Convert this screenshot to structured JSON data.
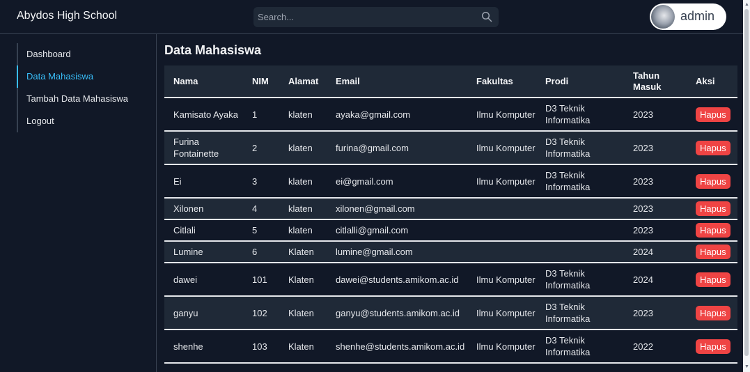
{
  "brand": "Abydos High School",
  "search": {
    "placeholder": "Search..."
  },
  "user": {
    "name": "admin"
  },
  "sidebar": {
    "items": [
      {
        "label": "Dashboard"
      },
      {
        "label": "Data Mahasiswa",
        "active": true
      },
      {
        "label": "Tambah Data Mahasiswa"
      },
      {
        "label": "Logout"
      }
    ]
  },
  "main": {
    "title": "Data Mahasiswa",
    "table": {
      "headers": [
        "Nama",
        "NIM",
        "Alamat",
        "Email",
        "Fakultas",
        "Prodi",
        "Tahun Masuk",
        "Aksi"
      ],
      "rows": [
        {
          "nama": "Kamisato Ayaka",
          "nim": "1",
          "alamat": "klaten",
          "email": "ayaka@gmail.com",
          "fakultas": "Ilmu Komputer",
          "prodi": "D3 Teknik Informatika",
          "tahun": "2023",
          "aksi": "Hapus"
        },
        {
          "nama": "Furina Fontainette",
          "nim": "2",
          "alamat": "klaten",
          "email": "furina@gmail.com",
          "fakultas": "Ilmu Komputer",
          "prodi": "D3 Teknik Informatika",
          "tahun": "2023",
          "aksi": "Hapus"
        },
        {
          "nama": "Ei",
          "nim": "3",
          "alamat": "klaten",
          "email": "ei@gmail.com",
          "fakultas": "Ilmu Komputer",
          "prodi": "D3 Teknik Informatika",
          "tahun": "2023",
          "aksi": "Hapus"
        },
        {
          "nama": "Xilonen",
          "nim": "4",
          "alamat": "klaten",
          "email": "xilonen@gmail.com",
          "fakultas": "",
          "prodi": "",
          "tahun": "2023",
          "aksi": "Hapus"
        },
        {
          "nama": "Citlali",
          "nim": "5",
          "alamat": "klaten",
          "email": "citlalli@gmail.com",
          "fakultas": "",
          "prodi": "",
          "tahun": "2023",
          "aksi": "Hapus"
        },
        {
          "nama": "Lumine",
          "nim": "6",
          "alamat": "Klaten",
          "email": "lumine@gmail.com",
          "fakultas": "",
          "prodi": "",
          "tahun": "2024",
          "aksi": "Hapus"
        },
        {
          "nama": "dawei",
          "nim": "101",
          "alamat": "Klaten",
          "email": "dawei@students.amikom.ac.id",
          "fakultas": "Ilmu Komputer",
          "prodi": "D3 Teknik Informatika",
          "tahun": "2024",
          "aksi": "Hapus"
        },
        {
          "nama": "ganyu",
          "nim": "102",
          "alamat": "Klaten",
          "email": "ganyu@students.amikom.ac.id",
          "fakultas": "Ilmu Komputer",
          "prodi": "D3 Teknik Informatika",
          "tahun": "2023",
          "aksi": "Hapus"
        },
        {
          "nama": "shenhe",
          "nim": "103",
          "alamat": "Klaten",
          "email": "shenhe@students.amikom.ac.id",
          "fakultas": "Ilmu Komputer",
          "prodi": "D3 Teknik Informatika",
          "tahun": "2022",
          "aksi": "Hapus"
        }
      ]
    }
  },
  "colors": {
    "background": "#111827",
    "surface": "#1f2937",
    "accent": "#38bdf8",
    "danger": "#ef4444"
  },
  "icons": {
    "search": "search-icon",
    "avatar": "avatar",
    "scroll_up": "scroll-up-arrow-icon",
    "scroll_down": "scroll-down-arrow-icon"
  }
}
